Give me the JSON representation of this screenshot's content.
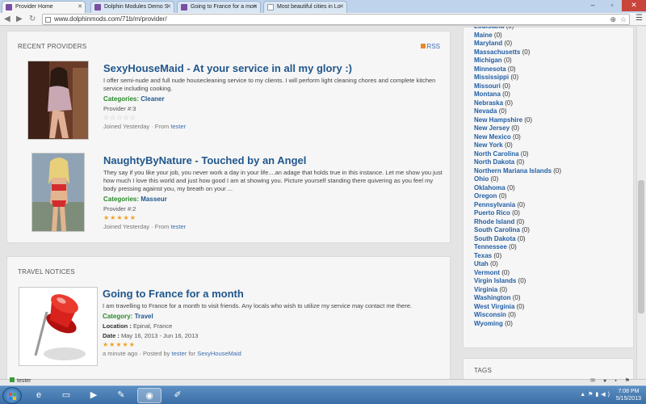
{
  "browser": {
    "tabs": [
      {
        "title": "Provider Home",
        "active": true
      },
      {
        "title": "Dolphin Modules Demo S"
      },
      {
        "title": "Going to France for a mon"
      },
      {
        "title": "Most beautiful cities in Lo"
      }
    ],
    "url": "www.dolphinmods.com/71b/m/provider/"
  },
  "providers": {
    "heading": "RECENT PROVIDERS",
    "rss": "RSS",
    "items": [
      {
        "title": "SexyHouseMaid - At your service in all my glory :)",
        "desc": "I offer semi-nude and full nude housecleaning service to my clients. I will perform light cleaning chores and complete kitchen service including cooking.",
        "cat_label": "Categories:",
        "cat_value": "Cleaner",
        "provider": "Provider #:3",
        "stars": "☆☆☆☆☆",
        "rating": 0,
        "joined": "Joined Yesterday · From",
        "from": "tester"
      },
      {
        "title": "NaughtyByNature - Touched by an Angel",
        "desc": "They say if you like your job, you never work a day in your life....an adage that holds true in this instance. Let me show you just how much I love this world and just how good I am at showing you. Picture yourself standing there quivering as you feel my body pressing against you, my breath on your ...",
        "cat_label": "Categories:",
        "cat_value": "Masseur",
        "provider": "Provider #:2",
        "stars": "★★★★★",
        "rating": 5,
        "joined": "Joined Yesterday · From",
        "from": "tester"
      }
    ]
  },
  "notices": {
    "heading": "TRAVEL NOTICES",
    "item": {
      "title": "Going to France for a month",
      "desc": "I am travelling to France for a month to visit friends. Any locals who wish to utilize my service may contact me there.",
      "cat_label": "Category:",
      "cat_value": "Travel",
      "loc_label": "Location :",
      "loc_value": "Epinal, France",
      "date_label": "Date :",
      "date_value": "May 16, 2013 - Jun 16, 2013",
      "stars": "★★★★★",
      "rating": 5,
      "posted": "a minute ago · Posted by",
      "by": "tester",
      "for_label": "for",
      "for_user": "SexyHouseMaid"
    }
  },
  "states": [
    {
      "name": "Louisiana",
      "count": "(0)"
    },
    {
      "name": "Maine",
      "count": "(0)"
    },
    {
      "name": "Maryland",
      "count": "(0)"
    },
    {
      "name": "Massachusetts",
      "count": "(0)"
    },
    {
      "name": "Michigan",
      "count": "(0)"
    },
    {
      "name": "Minnesota",
      "count": "(0)"
    },
    {
      "name": "Mississippi",
      "count": "(0)"
    },
    {
      "name": "Missouri",
      "count": "(0)"
    },
    {
      "name": "Montana",
      "count": "(0)"
    },
    {
      "name": "Nebraska",
      "count": "(0)"
    },
    {
      "name": "Nevada",
      "count": "(0)"
    },
    {
      "name": "New Hampshire",
      "count": "(0)"
    },
    {
      "name": "New Jersey",
      "count": "(0)"
    },
    {
      "name": "New Mexico",
      "count": "(0)"
    },
    {
      "name": "New York",
      "count": "(0)"
    },
    {
      "name": "North Carolina",
      "count": "(0)"
    },
    {
      "name": "North Dakota",
      "count": "(0)"
    },
    {
      "name": "Northern Mariana Islands",
      "count": "(0)"
    },
    {
      "name": "Ohio",
      "count": "(0)"
    },
    {
      "name": "Oklahoma",
      "count": "(0)"
    },
    {
      "name": "Oregon",
      "count": "(0)"
    },
    {
      "name": "Pennsylvania",
      "count": "(0)"
    },
    {
      "name": "Puerto Rico",
      "count": "(0)"
    },
    {
      "name": "Rhode Island",
      "count": "(0)"
    },
    {
      "name": "South Carolina",
      "count": "(0)"
    },
    {
      "name": "South Dakota",
      "count": "(0)"
    },
    {
      "name": "Tennessee",
      "count": "(0)"
    },
    {
      "name": "Texas",
      "count": "(0)"
    },
    {
      "name": "Utah",
      "count": "(0)"
    },
    {
      "name": "Vermont",
      "count": "(0)"
    },
    {
      "name": "Virgin Islands",
      "count": "(0)"
    },
    {
      "name": "Virginia",
      "count": "(0)"
    },
    {
      "name": "Washington",
      "count": "(0)"
    },
    {
      "name": "West Virginia",
      "count": "(0)"
    },
    {
      "name": "Wisconsin",
      "count": "(0)"
    },
    {
      "name": "Wyoming",
      "count": "(0)"
    }
  ],
  "tags": {
    "heading": "TAGS"
  },
  "dolbar": {
    "account": "tester"
  },
  "clock": {
    "time": "7:08 PM",
    "date": "5/15/2013"
  },
  "colors": {
    "link": "#21578c",
    "category": "#2a8a2a",
    "star": "#f0a020",
    "taskbar": "#3b6ea5"
  }
}
